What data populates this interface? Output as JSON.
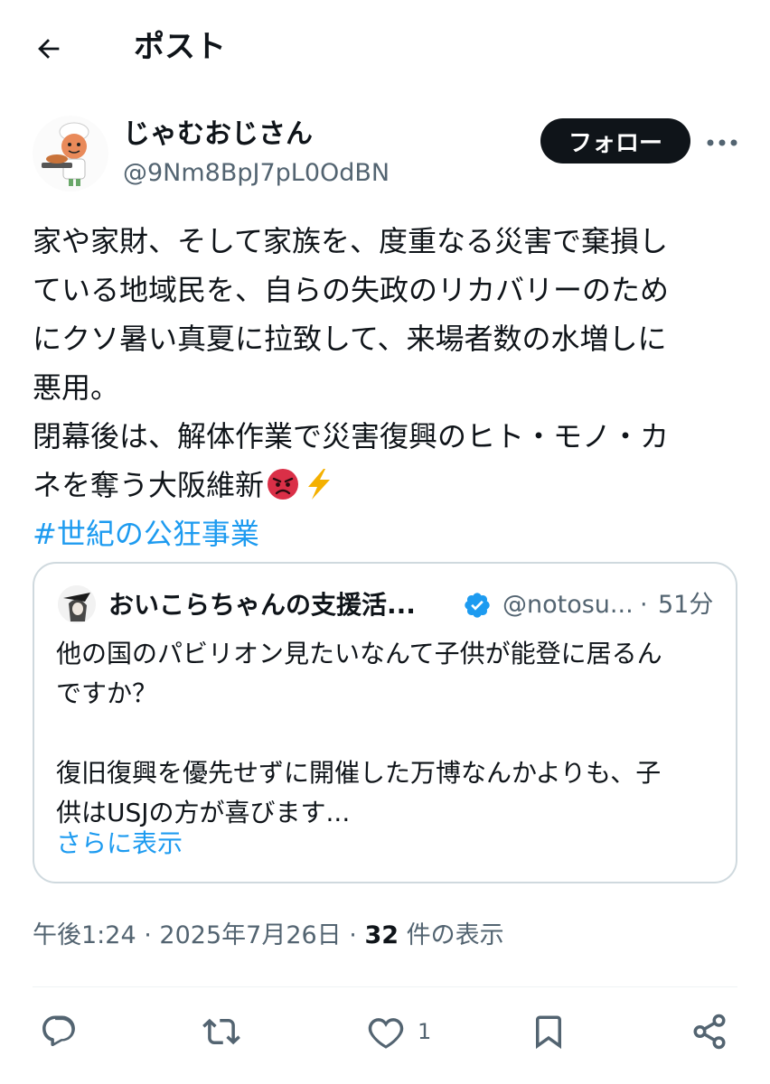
{
  "header": {
    "title": "ポスト"
  },
  "author": {
    "display_name": "じゃむおじさん",
    "handle": "@9Nm8BpJ7pL0OdBN",
    "follow_label": "フォロー"
  },
  "post": {
    "lines": [
      "家や家財、そして家族を、度重なる災害で棄損し",
      "ている地域民を、自らの失政のリカバリーのため",
      "にクソ暑い真夏に拉致して、来場者数の水増しに",
      "悪用。",
      "閉幕後は、解体作業で災害復興のヒト・モノ・カ",
      "ネを奪う大阪維新"
    ],
    "emojis": [
      "angry-face",
      "high-voltage"
    ],
    "hashtag": "#世紀の公狂事業"
  },
  "quote": {
    "name": "おいこらちゃんの支援活...",
    "handle": "@notosu...",
    "separator": "·",
    "time": "51分",
    "lines": [
      "他の国のパビリオン見たいなんて子供が能登に居るん",
      "ですか？",
      "",
      "復旧復興を優先せずに開催した万博なんかよりも、子",
      "供はUSJの方が喜びます..."
    ],
    "show_more": "さらに表示"
  },
  "meta": {
    "time": "午後1:24",
    "sep1": "·",
    "date": "2025年7月26日",
    "sep2": "·",
    "views": "32",
    "views_label": "件の表示"
  },
  "actions": {
    "like_count": "1"
  },
  "colors": {
    "accent": "#1d9bf0",
    "text": "#0f1419",
    "muted": "#536471",
    "border": "#cfd9de"
  }
}
